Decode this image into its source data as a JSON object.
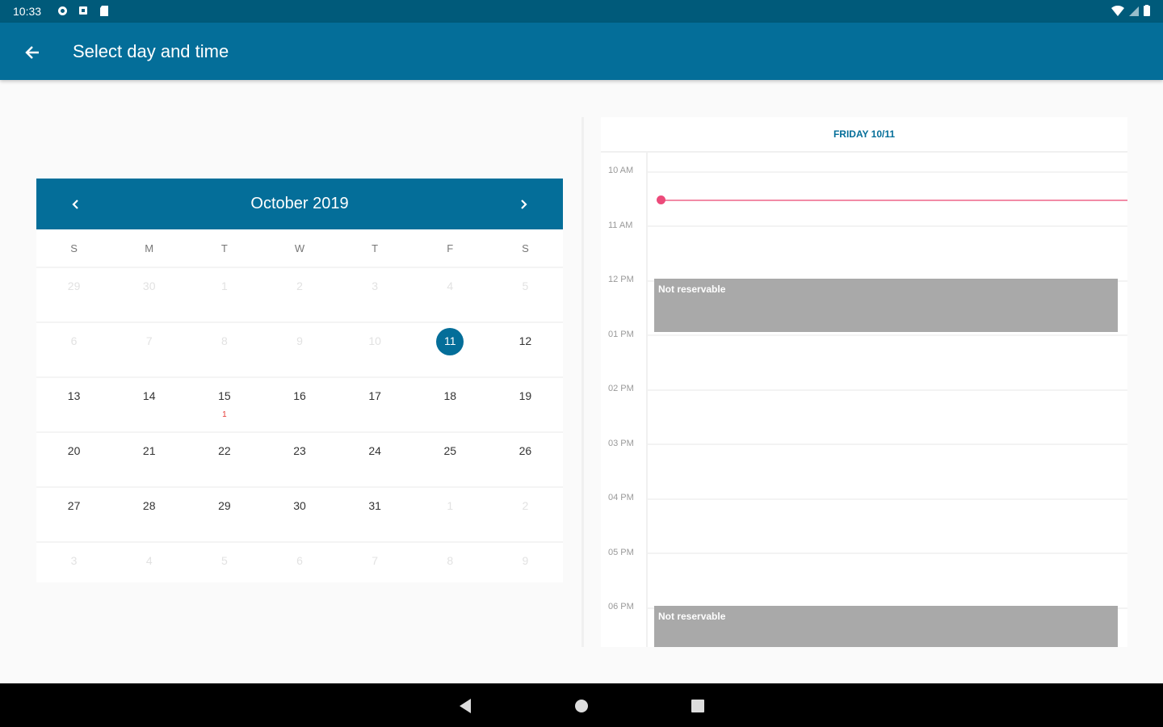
{
  "status": {
    "time": "10:33"
  },
  "appbar": {
    "title": "Select day and time"
  },
  "calendar": {
    "month_label": "October  2019",
    "weekdays": [
      "S",
      "M",
      "T",
      "W",
      "T",
      "F",
      "S"
    ],
    "weeks": [
      [
        "29",
        "30",
        "1",
        "2",
        "3",
        "4",
        "5"
      ],
      [
        "6",
        "7",
        "8",
        "9",
        "10",
        "11",
        "12"
      ],
      [
        "13",
        "14",
        "15",
        "16",
        "17",
        "18",
        "19"
      ],
      [
        "20",
        "21",
        "22",
        "23",
        "24",
        "25",
        "26"
      ],
      [
        "27",
        "28",
        "29",
        "30",
        "31",
        "1",
        "2"
      ],
      [
        "3",
        "4",
        "5",
        "6",
        "7",
        "8",
        "9"
      ]
    ],
    "marker": "1"
  },
  "schedule": {
    "date_header": "FRIDAY 10/11",
    "time_labels": [
      "10 AM",
      "11 AM",
      "12 PM",
      "01 PM",
      "02 PM",
      "03 PM",
      "04 PM",
      "05 PM",
      "06 PM"
    ],
    "events": [
      {
        "label": "Not reservable"
      },
      {
        "label": "Not reservable"
      }
    ]
  },
  "colors": {
    "primary": "#046e99",
    "status_bar": "#005a7a",
    "now_line": "#ec4a7a",
    "event": "#a9a9a9"
  }
}
